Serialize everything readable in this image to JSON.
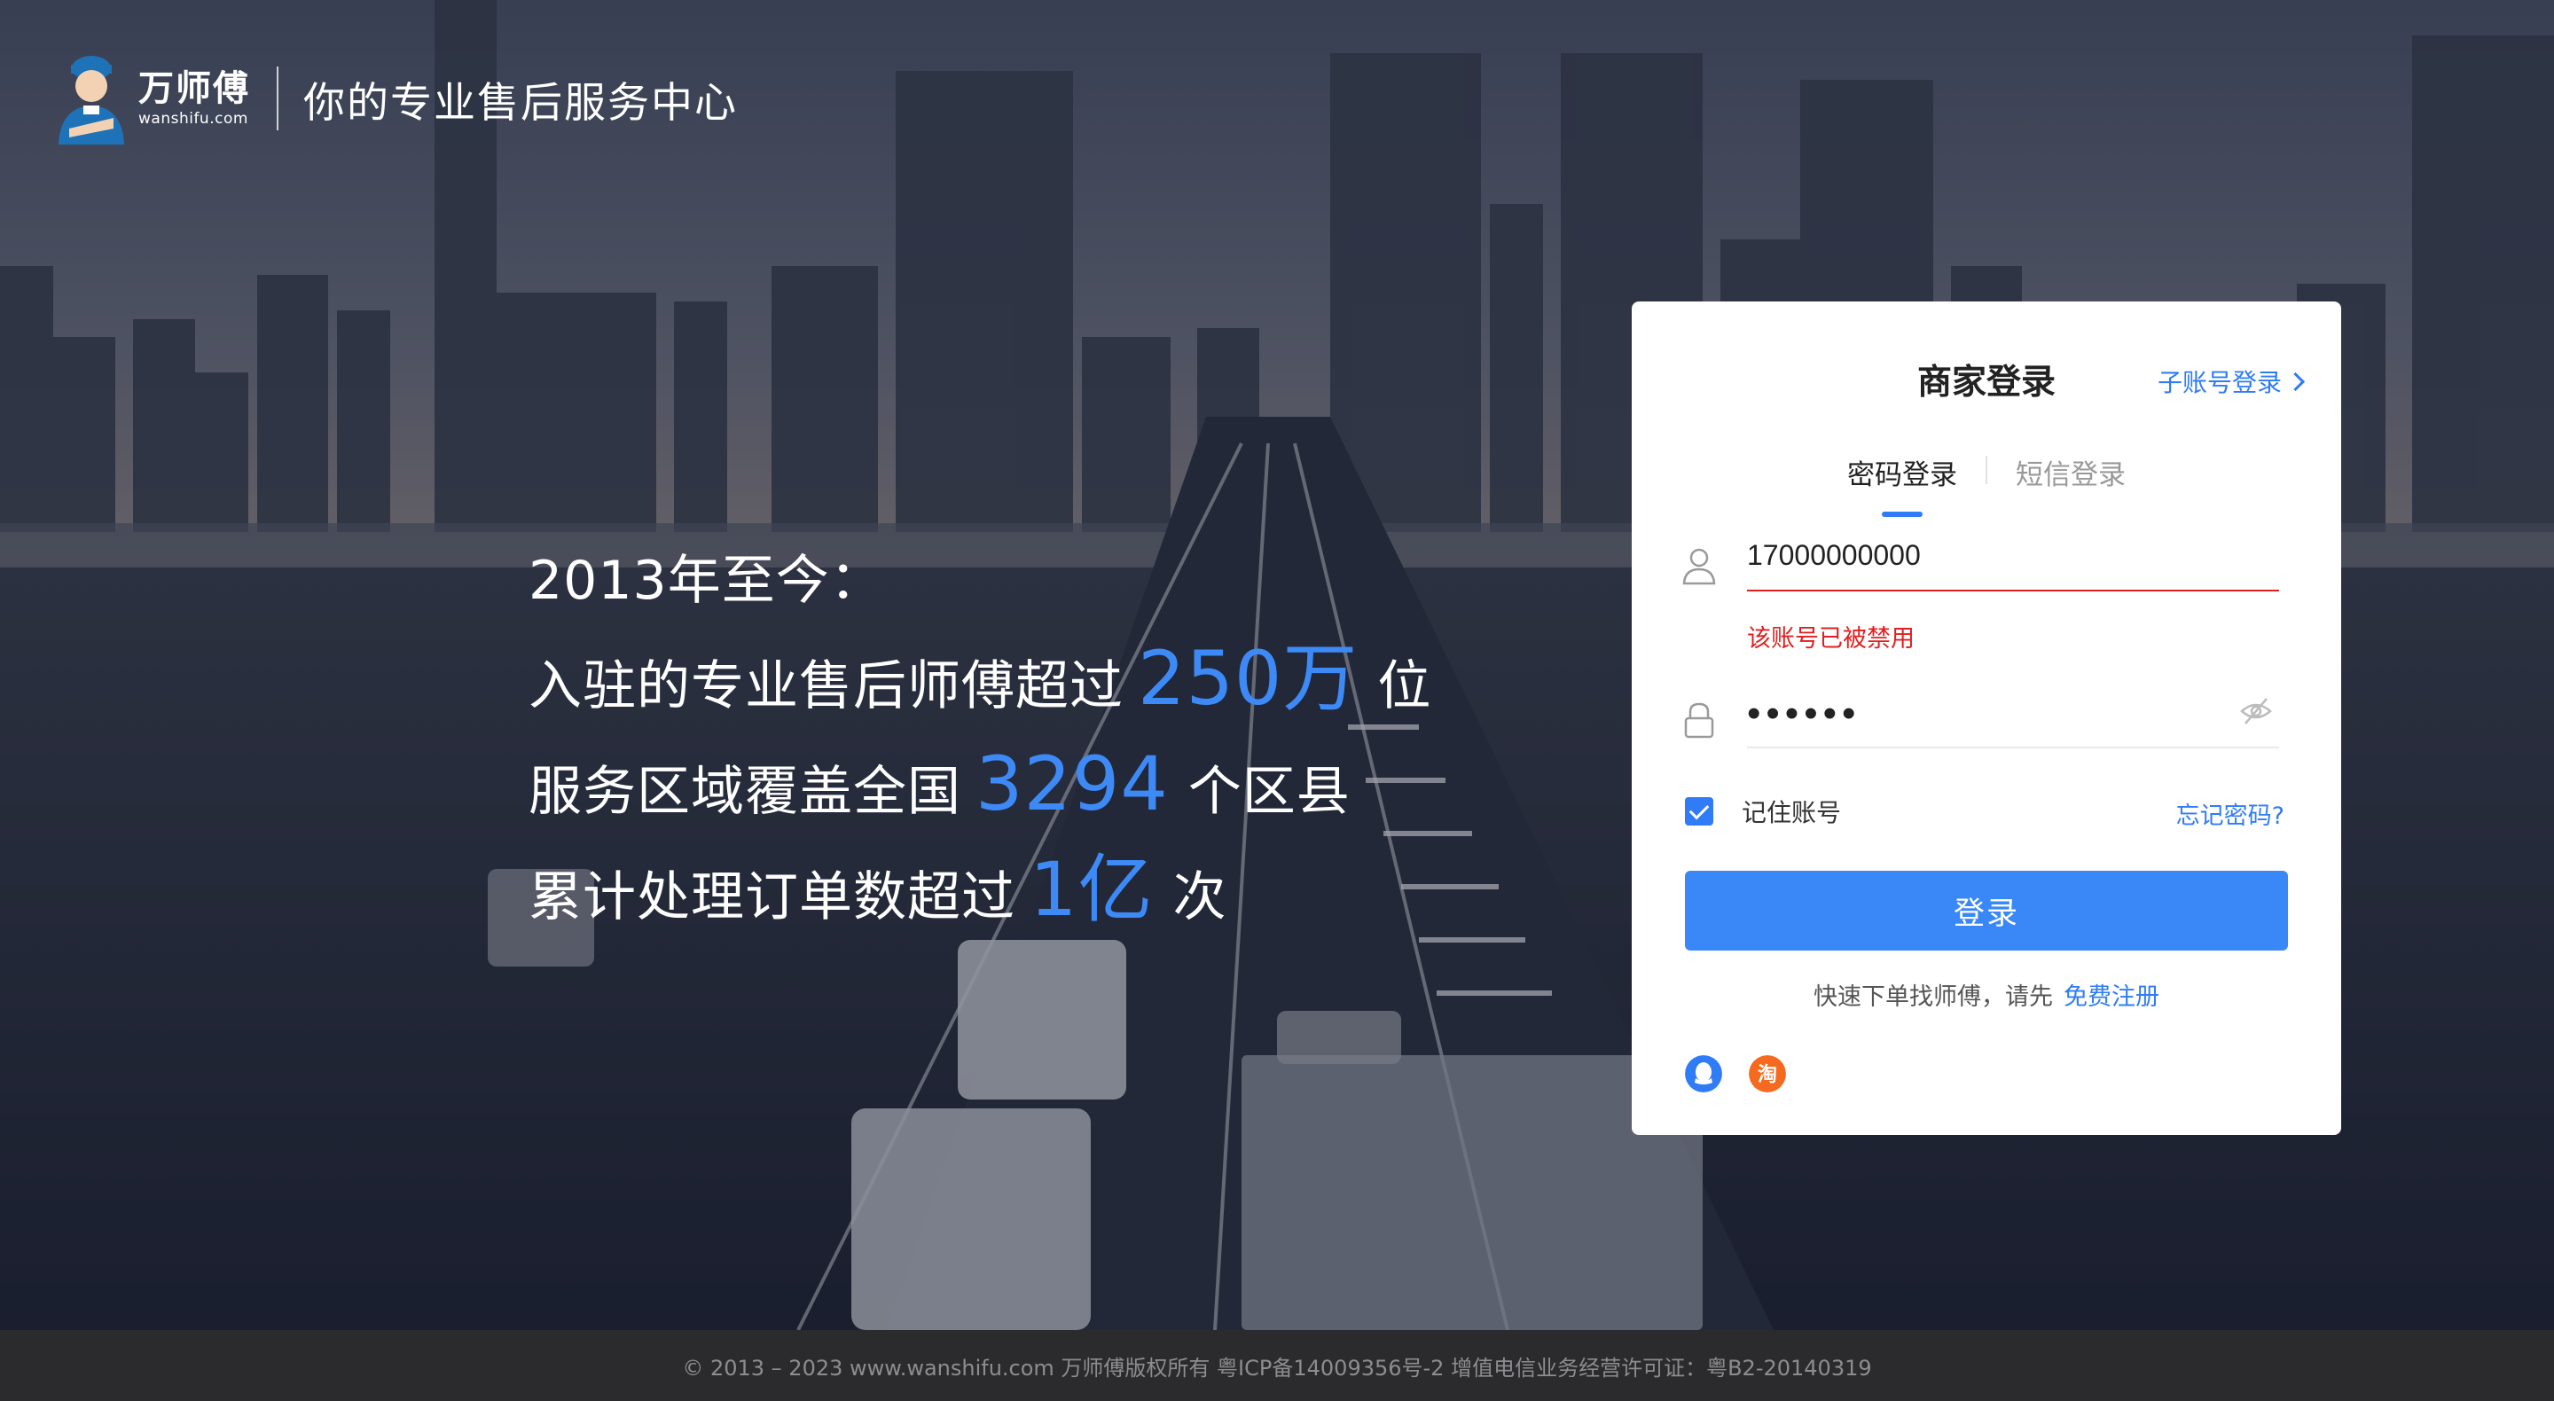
{
  "brand": {
    "name_cn": "万师傅",
    "name_en": "wanshifu.com",
    "slogan": "你的专业售后服务中心"
  },
  "stats": {
    "intro": "2013年至今：",
    "line1": {
      "prefix": "入驻的专业售后师傅超过",
      "value": "250万",
      "suffix": "位"
    },
    "line2": {
      "prefix": "服务区域覆盖全国",
      "value": "3294",
      "suffix": "个区县"
    },
    "line3": {
      "prefix": "累计处理订单数超过",
      "value": "1亿",
      "suffix": "次"
    }
  },
  "login": {
    "title": "商家登录",
    "sub_account_link": "子账号登录",
    "tabs": [
      {
        "label": "密码登录",
        "active": true
      },
      {
        "label": "短信登录",
        "active": false
      }
    ],
    "username_value": "17000000000",
    "username_error": "该账号已被禁用",
    "password_value": "••••••",
    "remember_label": "记住账号",
    "remember_checked": true,
    "forgot_link": "忘记密码?",
    "submit_label": "登录",
    "register_prompt": "快速下单找师傅，请先",
    "register_link": "免费注册",
    "social_icons": [
      "qq-icon",
      "taobao-icon"
    ]
  },
  "footer": {
    "text": "© 2013 – 2023 www.wanshifu.com 万师傅版权所有 粤ICP备14009356号-2 增值电信业务经营许可证：粤B2-20140319"
  },
  "colors": {
    "accent": "#3a88f7",
    "error": "#e02020",
    "footer_bg": "#2b2b2d",
    "stat_highlight": "#3d8af7"
  }
}
